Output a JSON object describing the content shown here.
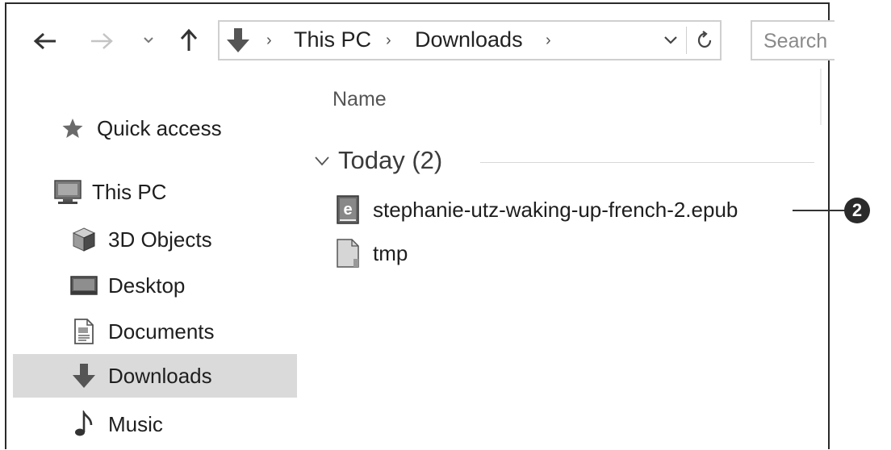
{
  "toolbar": {
    "back_icon": "back-arrow-icon",
    "forward_icon": "forward-arrow-icon",
    "recent_icon": "recent-locations-chevron-icon",
    "up_icon": "up-arrow-icon"
  },
  "address_bar": {
    "location_icon": "downloads-icon",
    "breadcrumbs": [
      "This PC",
      "Downloads"
    ],
    "separator": "›"
  },
  "search": {
    "placeholder": "Search"
  },
  "column_header": {
    "name": "Name"
  },
  "group": {
    "label": "Today (2)"
  },
  "files": [
    {
      "name": "stephanie-utz-waking-up-french-2.epub",
      "icon": "epub-file-icon"
    },
    {
      "name": "tmp",
      "icon": "generic-file-icon"
    }
  ],
  "callout": {
    "label": "2"
  },
  "sidebar": {
    "items": [
      {
        "label": "Quick access",
        "icon": "star-icon"
      },
      {
        "label": "This PC",
        "icon": "computer-icon"
      },
      {
        "label": "3D Objects",
        "icon": "cube-icon"
      },
      {
        "label": "Desktop",
        "icon": "desktop-icon"
      },
      {
        "label": "Documents",
        "icon": "document-icon"
      },
      {
        "label": "Downloads",
        "icon": "downloads-icon",
        "selected": true
      },
      {
        "label": "Music",
        "icon": "music-note-icon"
      }
    ]
  },
  "colors": {
    "selection": "#dadada",
    "border": "#2a2a2a",
    "muted": "#8a8a8a"
  }
}
